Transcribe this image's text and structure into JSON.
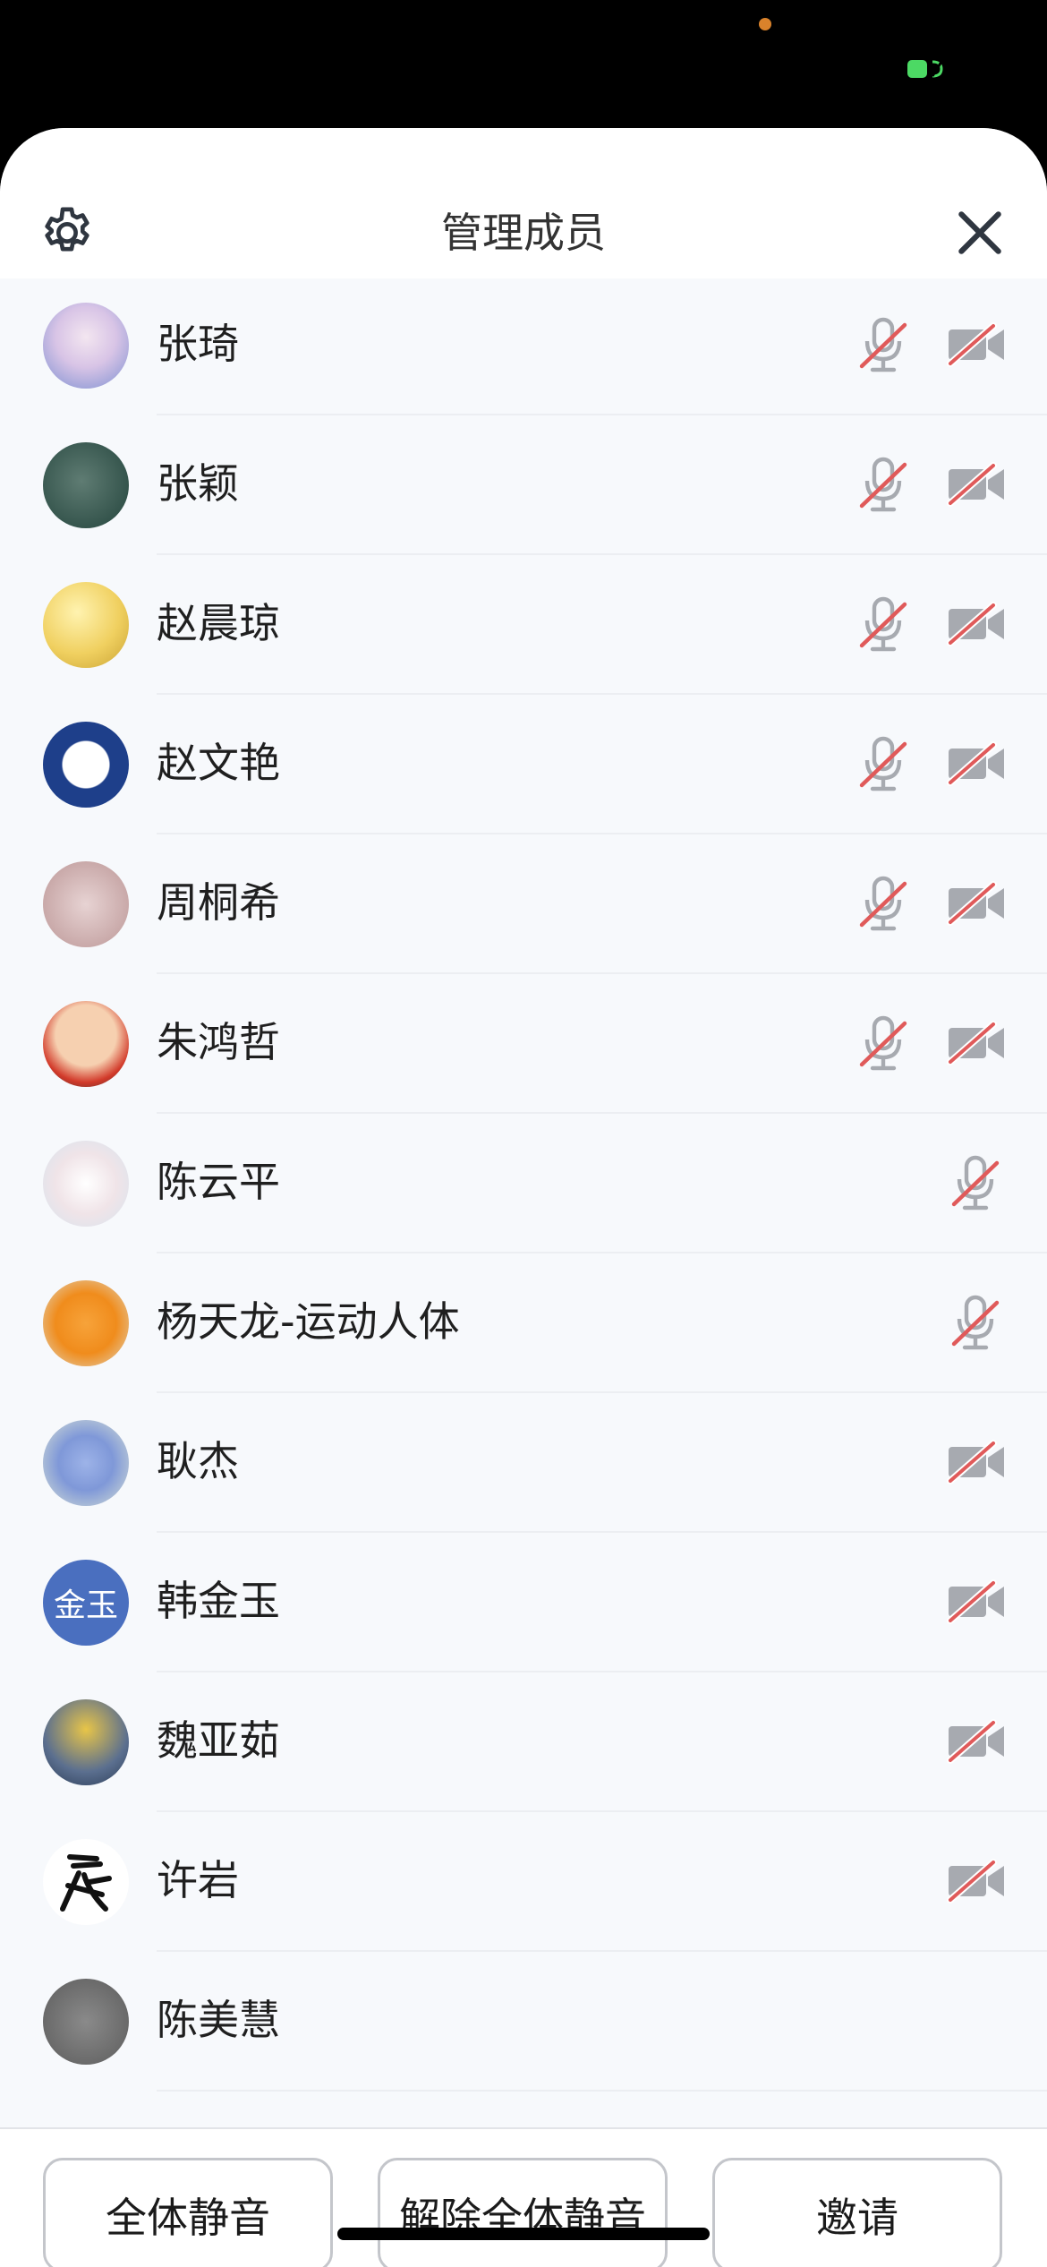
{
  "header": {
    "title": "管理成员",
    "settings_icon": "gear-icon",
    "close_icon": "close-icon"
  },
  "colors": {
    "accent_red": "#e05a5a",
    "icon_gray": "#a7aab0",
    "avatar_blue": "#4a6fbf"
  },
  "members": [
    {
      "name": "张琦",
      "mic_muted": true,
      "cam_off": true
    },
    {
      "name": "张颖",
      "mic_muted": true,
      "cam_off": true
    },
    {
      "name": "赵晨琼",
      "mic_muted": true,
      "cam_off": true
    },
    {
      "name": "赵文艳",
      "mic_muted": true,
      "cam_off": true
    },
    {
      "name": "周桐希",
      "mic_muted": true,
      "cam_off": true
    },
    {
      "name": "朱鸿哲",
      "mic_muted": true,
      "cam_off": true
    },
    {
      "name": "陈云平",
      "mic_muted": true,
      "cam_off": false
    },
    {
      "name": "杨天龙-运动人体",
      "mic_muted": true,
      "cam_off": false
    },
    {
      "name": "耿杰",
      "mic_muted": false,
      "cam_off": true
    },
    {
      "name": "韩金玉",
      "mic_muted": false,
      "cam_off": true,
      "avatar_text": "金玉"
    },
    {
      "name": "魏亚茹",
      "mic_muted": false,
      "cam_off": true
    },
    {
      "name": "许岩",
      "mic_muted": false,
      "cam_off": true
    },
    {
      "name": "陈美慧",
      "mic_muted": false,
      "cam_off": false
    }
  ],
  "footer": {
    "mute_all_label": "全体静音",
    "unmute_all_label": "解除全体静音",
    "invite_label": "邀请"
  }
}
